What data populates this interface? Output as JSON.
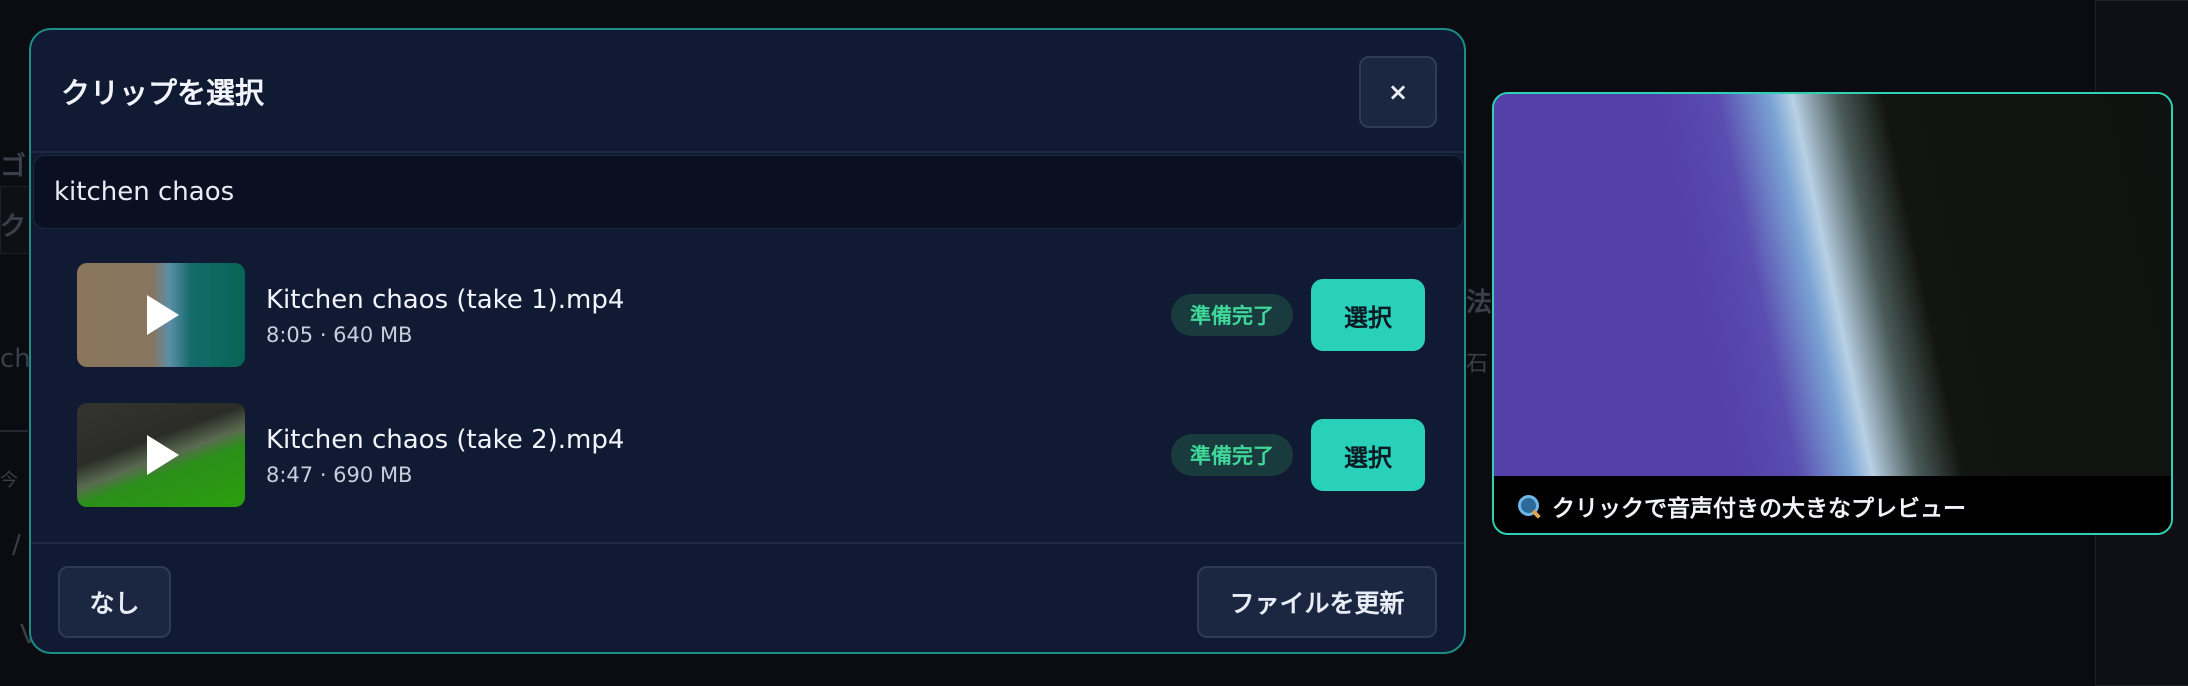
{
  "modal": {
    "title": "クリップを選択",
    "close_label": "×",
    "search": {
      "value": "kitchen chaos",
      "placeholder": ""
    },
    "clips": [
      {
        "name": "Kitchen chaos (take 1).mp4",
        "meta": "8:05 · 640 MB",
        "status": "準備完了",
        "select_label": "選択"
      },
      {
        "name": "Kitchen chaos (take 2).mp4",
        "meta": "8:47 · 690 MB",
        "status": "準備完了",
        "select_label": "選択"
      }
    ],
    "footer": {
      "none_label": "なし",
      "refresh_label": "ファイルを更新"
    }
  },
  "preview": {
    "caption": "クリックで音声付きの大きなプレビュー",
    "caption_icon": "magnifier-icon"
  },
  "colors": {
    "accent": "#2ad1ba",
    "status_text": "#3fd89a",
    "modal_background": "#101a33"
  }
}
